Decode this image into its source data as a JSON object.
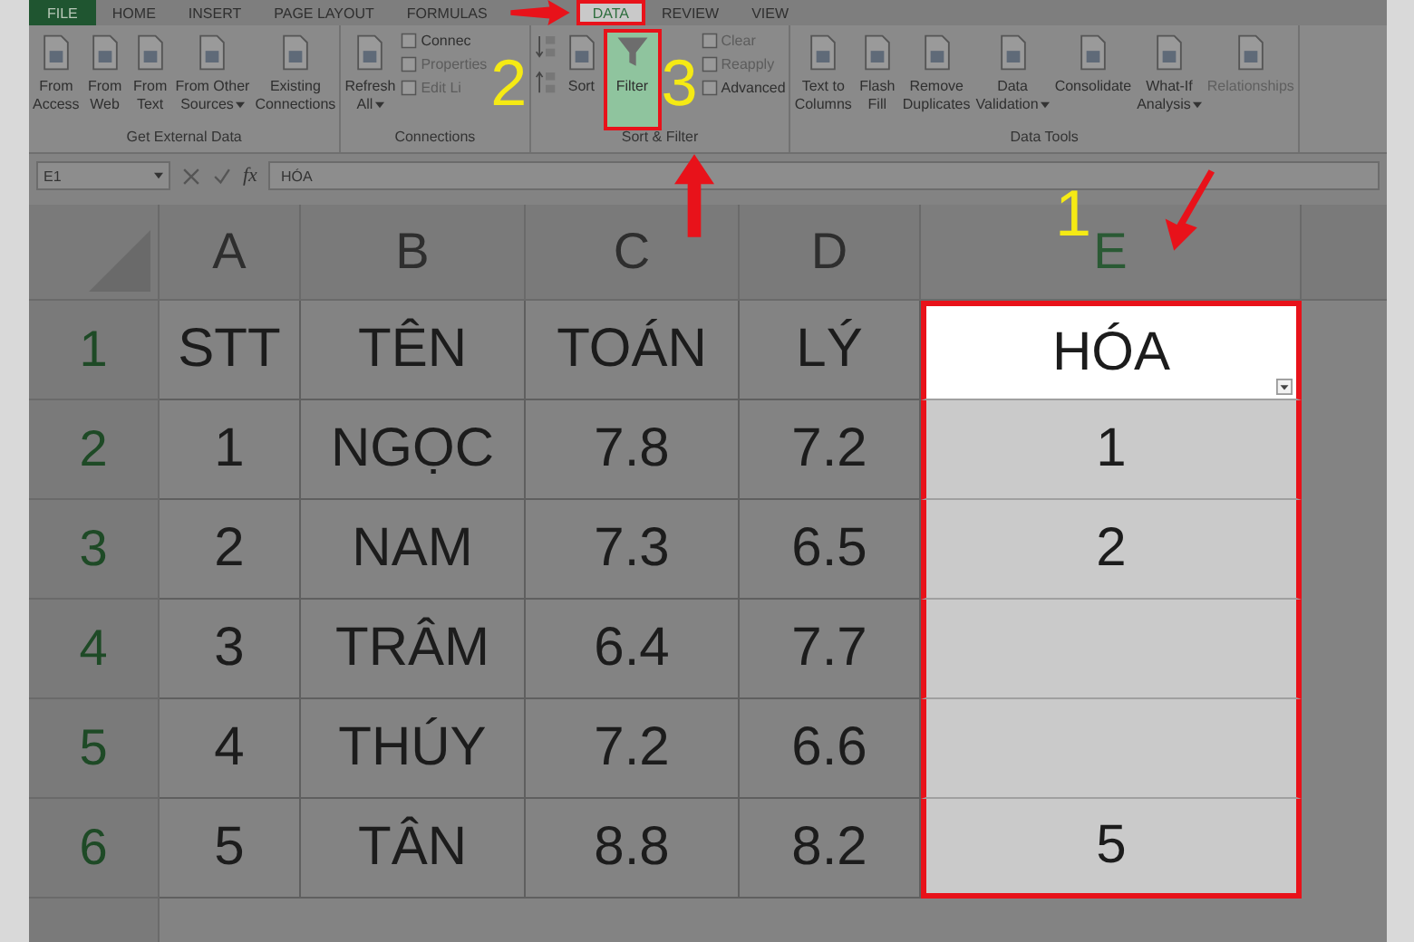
{
  "ribbon_tabs": [
    {
      "label": "FILE",
      "selected": false,
      "kind": "file",
      "annotated": false
    },
    {
      "label": "HOME",
      "selected": false,
      "kind": "tab",
      "annotated": false
    },
    {
      "label": "INSERT",
      "selected": false,
      "kind": "tab",
      "annotated": false
    },
    {
      "label": "PAGE LAYOUT",
      "selected": false,
      "kind": "tab",
      "annotated": false
    },
    {
      "label": "FORMULAS",
      "selected": false,
      "kind": "tab",
      "annotated": false
    },
    {
      "label": "DATA",
      "selected": true,
      "kind": "tab",
      "annotated": true,
      "step": "2"
    },
    {
      "label": "REVIEW",
      "selected": false,
      "kind": "tab",
      "annotated": false
    },
    {
      "label": "VIEW",
      "selected": false,
      "kind": "tab",
      "annotated": false
    }
  ],
  "ribbon_groups": [
    {
      "label": "Get External Data",
      "buttons": [
        {
          "kind": "large",
          "lines": [
            "From",
            "Access"
          ],
          "dropdown": false,
          "annotated": false,
          "disabled": false
        },
        {
          "kind": "large",
          "lines": [
            "From",
            "Web"
          ],
          "dropdown": false,
          "annotated": false,
          "disabled": false
        },
        {
          "kind": "large",
          "lines": [
            "From",
            "Text"
          ],
          "dropdown": false,
          "annotated": false,
          "disabled": false
        },
        {
          "kind": "large",
          "lines": [
            "From Other",
            "Sources"
          ],
          "dropdown": true,
          "annotated": false,
          "disabled": false
        },
        {
          "kind": "large",
          "lines": [
            "Existing",
            "Connections"
          ],
          "dropdown": false,
          "annotated": false,
          "disabled": false
        }
      ]
    },
    {
      "label": "Connections",
      "buttons": [
        {
          "kind": "large",
          "lines": [
            "Refresh",
            "All"
          ],
          "dropdown": true,
          "annotated": false,
          "disabled": false
        },
        {
          "kind": "stack",
          "items": [
            {
              "label": "Connec",
              "disabled": false
            },
            {
              "label": "Properties",
              "disabled": true
            },
            {
              "label": "Edit Li",
              "disabled": true
            }
          ]
        }
      ]
    },
    {
      "label": "Sort & Filter",
      "buttons": [
        {
          "kind": "sortaz"
        },
        {
          "kind": "large",
          "lines": [
            "Sort"
          ],
          "dropdown": false,
          "annotated": false,
          "disabled": false
        },
        {
          "kind": "large",
          "lines": [
            "Filter"
          ],
          "dropdown": false,
          "annotated": true,
          "disabled": false,
          "step": "3"
        },
        {
          "kind": "stack",
          "items": [
            {
              "label": "Clear",
              "disabled": true
            },
            {
              "label": "Reapply",
              "disabled": true
            },
            {
              "label": "Advanced",
              "disabled": false
            }
          ]
        }
      ]
    },
    {
      "label": "Data Tools",
      "buttons": [
        {
          "kind": "large",
          "lines": [
            "Text to",
            "Columns"
          ],
          "dropdown": false,
          "annotated": false,
          "disabled": false
        },
        {
          "kind": "large",
          "lines": [
            "Flash",
            "Fill"
          ],
          "dropdown": false,
          "annotated": false,
          "disabled": false
        },
        {
          "kind": "large",
          "lines": [
            "Remove",
            "Duplicates"
          ],
          "dropdown": false,
          "annotated": false,
          "disabled": false
        },
        {
          "kind": "large",
          "lines": [
            "Data",
            "Validation"
          ],
          "dropdown": true,
          "annotated": false,
          "disabled": false
        },
        {
          "kind": "large",
          "lines": [
            "Consolidate"
          ],
          "dropdown": false,
          "annotated": false,
          "disabled": false
        },
        {
          "kind": "large",
          "lines": [
            "What-If",
            "Analysis"
          ],
          "dropdown": true,
          "annotated": false,
          "disabled": false
        },
        {
          "kind": "large",
          "lines": [
            "Relationships"
          ],
          "dropdown": false,
          "annotated": false,
          "disabled": true
        }
      ]
    }
  ],
  "formula_bar": {
    "name_box": "E1",
    "function_label": "fx",
    "formula": "HÓA"
  },
  "sheet": {
    "columns": [
      {
        "label": "A",
        "selected": false
      },
      {
        "label": "B",
        "selected": false
      },
      {
        "label": "C",
        "selected": false
      },
      {
        "label": "D",
        "selected": false
      },
      {
        "label": "E",
        "selected": true,
        "step": "1"
      }
    ],
    "rows": [
      {
        "label": "1",
        "cells": [
          "STT",
          "TÊN",
          "TOÁN",
          "LÝ",
          "HÓA"
        ]
      },
      {
        "label": "2",
        "cells": [
          "1",
          "NGỌC",
          "7.8",
          "7.2",
          "1"
        ]
      },
      {
        "label": "3",
        "cells": [
          "2",
          "NAM",
          "7.3",
          "6.5",
          "2"
        ]
      },
      {
        "label": "4",
        "cells": [
          "3",
          "TRÂM",
          "6.4",
          "7.7",
          ""
        ]
      },
      {
        "label": "5",
        "cells": [
          "4",
          "THÚY",
          "7.2",
          "6.6",
          ""
        ]
      },
      {
        "label": "6",
        "cells": [
          "5",
          "TÂN",
          "8.8",
          "8.2",
          "5"
        ]
      }
    ],
    "active_cell_filter_button": true
  }
}
